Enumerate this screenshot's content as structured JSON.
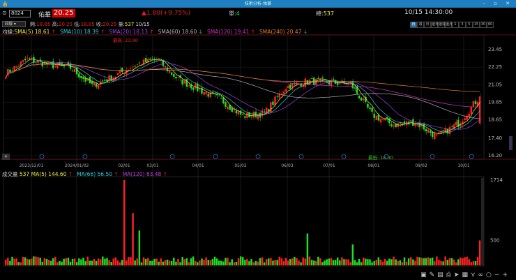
{
  "window": {
    "title": "技術分析-佑華",
    "controls": "–  ▫  ✕"
  },
  "quote": {
    "code": "8024",
    "name": "佑華",
    "price": "20.25",
    "change": "▲1.80(+9.75%)",
    "single_label": "單:",
    "single": "4",
    "total_label": "總:",
    "total": "537",
    "datetime": "10/15 14:30:00"
  },
  "ohlc": {
    "period": "日線",
    "open_label": "開:",
    "open": "18.85",
    "high_label": "高:",
    "high": "20.25",
    "low_label": "低:",
    "low": "18.85",
    "close_label": "收:",
    "close": "20.25",
    "vol_label": "量:",
    "vol": "537",
    "date": "10/15"
  },
  "period_buttons": [
    "日",
    "週",
    "月",
    "還日",
    "還週",
    "還月",
    "1",
    "3",
    "5",
    "15",
    "30",
    "60"
  ],
  "ma": {
    "label": "均線:",
    "items": [
      {
        "text": "SMA(5) 18.61",
        "arrow": "↑",
        "color": "#e8e840"
      },
      {
        "text": "SMA(10) 18.39",
        "arrow": "↑",
        "color": "#30c8d8"
      },
      {
        "text": "SMA(20) 18.13",
        "arrow": "↑",
        "color": "#a040e0"
      },
      {
        "text": "SMA(60) 18.60",
        "arrow": "↓",
        "color": "#b0b0b0"
      },
      {
        "text": "SMA(120) 19.41",
        "arrow": "↑",
        "color": "#d030c0"
      },
      {
        "text": "SMA(240) 20.47",
        "arrow": "↓",
        "color": "#e08020"
      }
    ]
  },
  "vol_ma": {
    "label": "成交量",
    "value": "537",
    "items": [
      {
        "text": "MA(5) 144.60",
        "arrow": "↑",
        "color": "#e8e840"
      },
      {
        "text": "MA(66) 56.50",
        "arrow": "↑",
        "color": "#30c8d8"
      },
      {
        "text": "MA(120) 83.48",
        "arrow": "↑",
        "color": "#c040e0"
      }
    ]
  },
  "annotations": {
    "high": "最高: 23.90",
    "low": "最低: 16.30"
  },
  "chart_data": {
    "type": "candlestick",
    "price_ticks": [
      "23.45",
      "22.25",
      "21.05",
      "19.85",
      "18.65",
      "17.40",
      "16.20"
    ],
    "price_range": [
      16.2,
      23.45
    ],
    "volume_ticks": [
      "1714",
      "500"
    ],
    "volume_range": [
      0,
      1714
    ],
    "date_labels": [
      "2023/12/01",
      "2024/01/02",
      "02/01",
      "03/01",
      "04/01",
      "05/02",
      "06/03",
      "07/01",
      "08/01",
      "09/02",
      "10/01"
    ],
    "close_anchors_every_10_bars": [
      21.8,
      22.8,
      22.4,
      22.2,
      21.0,
      21.6,
      22.4,
      22.8,
      21.4,
      20.7,
      20.0,
      18.9,
      19.1,
      20.9,
      21.3,
      21.2,
      21.1,
      19.0,
      18.3,
      18.5,
      17.5,
      18.4,
      20.25
    ],
    "volume_spikes": [
      {
        "bar": 55,
        "volume": 1714
      },
      {
        "bar": 59,
        "volume": 1050
      },
      {
        "bar": 62,
        "volume": 700
      },
      {
        "bar": 140,
        "volume": 640
      },
      {
        "bar": 161,
        "volume": 420
      },
      {
        "bar": 220,
        "volume": 500
      }
    ],
    "up_color": "#ff2020",
    "down_color": "#20e020"
  },
  "toolbar_icons": [
    "settings-icon",
    "draw-icon",
    "window-icon",
    "print-icon",
    "cursor-icon",
    "grid-icon",
    "indicator-icon",
    "link-icon",
    "reset-icon",
    "zoom-out-icon",
    "zoom-in-icon"
  ]
}
